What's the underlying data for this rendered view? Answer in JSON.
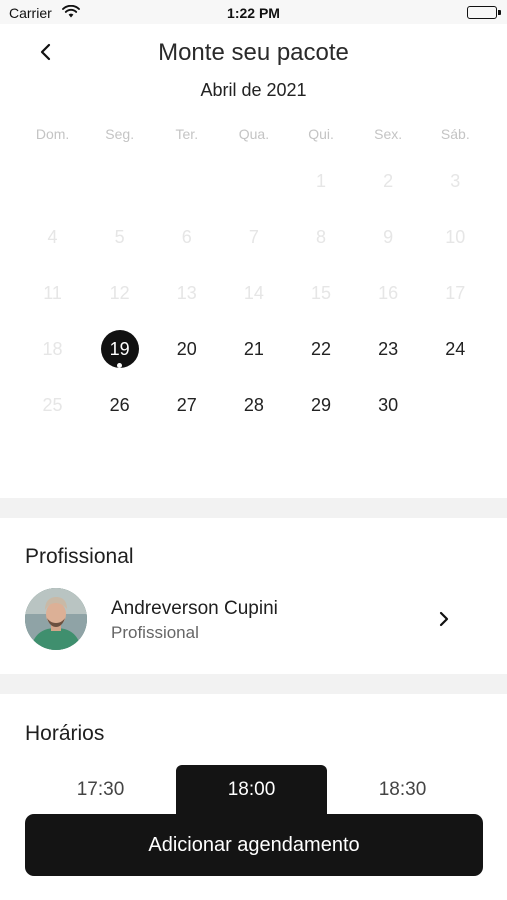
{
  "status_bar": {
    "carrier": "Carrier",
    "time": "1:22 PM"
  },
  "header": {
    "title": "Monte seu pacote"
  },
  "calendar": {
    "month": "Abril de 2021",
    "weekdays": [
      "Dom.",
      "Seg.",
      "Ter.",
      "Qua.",
      "Qui.",
      "Sex.",
      "Sáb."
    ],
    "cells": [
      {
        "label": "",
        "state": "empty"
      },
      {
        "label": "",
        "state": "empty"
      },
      {
        "label": "",
        "state": "empty"
      },
      {
        "label": "",
        "state": "empty"
      },
      {
        "label": "1",
        "state": "disabled"
      },
      {
        "label": "2",
        "state": "disabled"
      },
      {
        "label": "3",
        "state": "disabled"
      },
      {
        "label": "4",
        "state": "disabled"
      },
      {
        "label": "5",
        "state": "disabled"
      },
      {
        "label": "6",
        "state": "disabled"
      },
      {
        "label": "7",
        "state": "disabled"
      },
      {
        "label": "8",
        "state": "disabled"
      },
      {
        "label": "9",
        "state": "disabled"
      },
      {
        "label": "10",
        "state": "disabled"
      },
      {
        "label": "11",
        "state": "disabled"
      },
      {
        "label": "12",
        "state": "disabled"
      },
      {
        "label": "13",
        "state": "disabled"
      },
      {
        "label": "14",
        "state": "disabled"
      },
      {
        "label": "15",
        "state": "disabled"
      },
      {
        "label": "16",
        "state": "disabled"
      },
      {
        "label": "17",
        "state": "disabled"
      },
      {
        "label": "18",
        "state": "disabled"
      },
      {
        "label": "19",
        "state": "selected"
      },
      {
        "label": "20",
        "state": "active"
      },
      {
        "label": "21",
        "state": "active"
      },
      {
        "label": "22",
        "state": "active"
      },
      {
        "label": "23",
        "state": "active"
      },
      {
        "label": "24",
        "state": "active"
      },
      {
        "label": "25",
        "state": "disabled"
      },
      {
        "label": "26",
        "state": "active"
      },
      {
        "label": "27",
        "state": "active"
      },
      {
        "label": "28",
        "state": "active"
      },
      {
        "label": "29",
        "state": "active"
      },
      {
        "label": "30",
        "state": "active"
      }
    ]
  },
  "professional": {
    "section_title": "Profissional",
    "name": "Andreverson Cupini",
    "role": "Profissional"
  },
  "schedule": {
    "section_title": "Horários",
    "slots": [
      {
        "time": "17:30",
        "selected": false
      },
      {
        "time": "18:00",
        "selected": true
      },
      {
        "time": "18:30",
        "selected": false
      }
    ]
  },
  "actions": {
    "add_label": "Adicionar agendamento"
  },
  "colors": {
    "primary": "#141414",
    "disabled_text": "#e6e6e6",
    "divider": "#f2f2f2"
  }
}
